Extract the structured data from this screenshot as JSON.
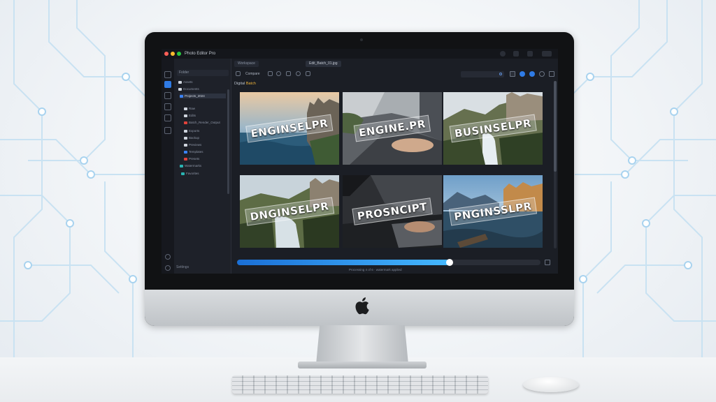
{
  "window": {
    "title": "Photo Editor Pro",
    "tab_left": "Workspace",
    "tab_active": "Edit_Batch_01.jpg"
  },
  "colors": {
    "accent": "#2f7be5",
    "progress_start": "#1a6fd6",
    "progress_end": "#45b8ff",
    "close": "#ff5f57",
    "minimize": "#febc2e",
    "zoom": "#28c840"
  },
  "rail": {
    "icons": [
      "home-icon",
      "brush-icon",
      "layers-icon",
      "shield-icon",
      "pen-icon",
      "folder-icon"
    ],
    "bottom_icons": [
      "sync-icon",
      "settings-icon"
    ]
  },
  "sidebar": {
    "search_placeholder": "Folder",
    "items": [
      {
        "label": "Assets",
        "icon": "folder-icon"
      },
      {
        "label": "Documents",
        "icon": "folder-icon"
      },
      {
        "label": "Projects_2024",
        "icon": "folder-icon"
      },
      {
        "label": "Raw",
        "icon": "file-icon"
      },
      {
        "label": "Edits",
        "icon": "file-icon"
      },
      {
        "label": "Batch_Render_Output",
        "icon": "file-icon"
      },
      {
        "label": "Exports",
        "icon": "file-icon"
      },
      {
        "label": "Backup",
        "icon": "file-icon"
      },
      {
        "label": "Previews",
        "icon": "file-icon"
      },
      {
        "label": "Templates",
        "icon": "file-icon"
      },
      {
        "label": "Presets",
        "icon": "file-icon"
      },
      {
        "label": "Watermarks",
        "icon": "file-icon"
      },
      {
        "label": "Favorites",
        "icon": "file-icon"
      }
    ],
    "footer": "Settings"
  },
  "toolbar": {
    "label": "Compare",
    "tools": [
      "crop-icon",
      "brush-icon",
      "eraser-icon",
      "filter-icon",
      "grid-icon"
    ],
    "search_placeholder": "",
    "controls": [
      "square-icon",
      "circle-blue-icon",
      "circle-blue-icon",
      "sync-icon",
      "menu-icon"
    ]
  },
  "gallery": {
    "section_title": "Digital",
    "section_badge": "Batch",
    "items": [
      {
        "watermark": "ENGINSELPR",
        "scene": "ocean-coast"
      },
      {
        "watermark": "ENGINE.PR",
        "scene": "hands-on-laptop-street"
      },
      {
        "watermark": "BUSINSELPR",
        "scene": "waterfall-town"
      },
      {
        "watermark": "DNGINSELPR",
        "scene": "river-valley-town"
      },
      {
        "watermark": "PROSNCIPT",
        "scene": "hands-typing-dark"
      },
      {
        "watermark": "PNGINSSLPR",
        "scene": "lake-mountain-town"
      }
    ]
  },
  "progress": {
    "value": 0.7,
    "status": "Processing 4 of 6 · watermark applied"
  }
}
